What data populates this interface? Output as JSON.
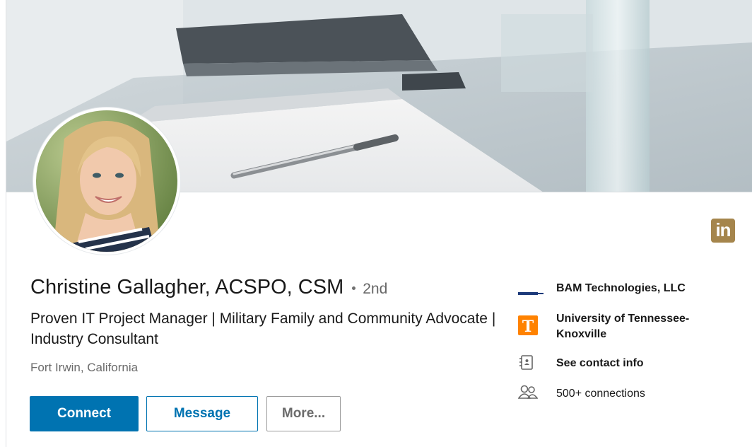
{
  "profile": {
    "name": "Christine Gallagher, ACSPO, CSM",
    "degree": "2nd",
    "headline": "Proven IT Project Manager | Military Family and Community Advocate | Industry Consultant",
    "location": "Fort Irwin, California"
  },
  "actions": {
    "connect": "Connect",
    "message": "Message",
    "more": "More..."
  },
  "sidebar": {
    "company": "BAM Technologies, LLC",
    "school_line1": "University of Tennessee-",
    "school_line2": "Knoxville",
    "school_logo_letter": "T",
    "contact": "See contact info",
    "connections": "500+ connections"
  },
  "badge": {
    "text": "in"
  },
  "colors": {
    "primary": "#0073b1",
    "linkedin_premium": "#a5854c",
    "tennessee_orange": "#ff8200"
  }
}
